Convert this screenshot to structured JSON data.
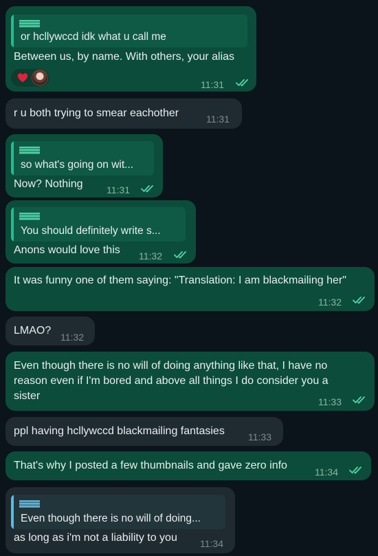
{
  "chat": {
    "messages": [
      {
        "direction": "outgoing",
        "quote_text": "or hcllywccd idk what u call me",
        "text": "Between us, by name. With others, your alias",
        "time": "11:31",
        "status": "read",
        "reactions": [
          "heart-icon",
          "avatar"
        ]
      },
      {
        "direction": "incoming",
        "text": "r u both trying to smear eachother",
        "time": "11:31"
      },
      {
        "direction": "outgoing",
        "quote_text": "so what's going on wit...",
        "text": "Now? Nothing",
        "time": "11:31",
        "status": "read"
      },
      {
        "direction": "outgoing",
        "quote_text": "You should definitely write s...",
        "text": "Anons would love this",
        "time": "11:32",
        "status": "read"
      },
      {
        "direction": "outgoing",
        "text": "It was funny one of them saying: \"Translation: I am blackmailing her\"",
        "time": "11:32",
        "status": "read"
      },
      {
        "direction": "incoming",
        "text": "LMAO?",
        "time": "11:32"
      },
      {
        "direction": "outgoing",
        "text": "Even though there is no will of doing anything like that, I have no reason even if I'm bored and above all things I do consider you a sister",
        "time": "11:33",
        "status": "read"
      },
      {
        "direction": "incoming",
        "text": "ppl having hcllywccd blackmailing fantasies",
        "time": "11:33"
      },
      {
        "direction": "outgoing",
        "text": "That's why I posted a few thumbnails and gave zero info",
        "time": "11:34",
        "status": "read"
      },
      {
        "direction": "incoming",
        "quote_text": "Even though there is no will of doing...",
        "text": "as long as i'm not a liability to you",
        "time": "11:34"
      }
    ]
  },
  "colors": {
    "background": "#0b141a",
    "outgoing_bubble": "#0b4d3a",
    "incoming_bubble": "#1f2b31",
    "read_ticks": "#53d6a8"
  }
}
